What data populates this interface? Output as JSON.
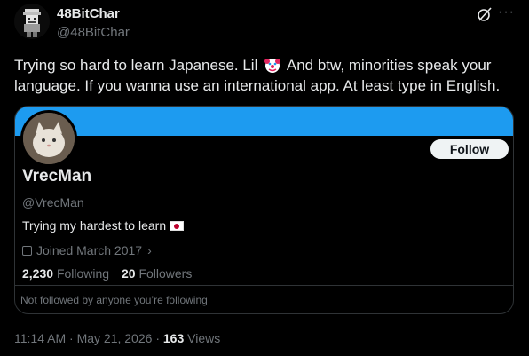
{
  "post": {
    "author_name": "48BitChar",
    "author_handle": "@48BitChar",
    "text_before_emoji": "Trying so hard to learn Japanese. Lil ",
    "emoji_icon": "clown-face-icon",
    "text_after_emoji": " And btw, minorities speak your language. If you wanna use an international app. At least type in English.",
    "more_icon": "more-horizontal-icon",
    "grok_icon": "grok-icon"
  },
  "card": {
    "banner_color": "#1d9bf0",
    "follow_label": "Follow",
    "name": "VrecMan",
    "handle": "@VrecMan",
    "bio": "Trying my hardest to learn",
    "bio_icon": "japan-flag-icon",
    "joined": "Joined March 2017",
    "following_count": "2,230",
    "following_label": "Following",
    "followers_count": "20",
    "followers_label": "Followers",
    "footer": "Not followed by anyone you’re following"
  },
  "meta": {
    "time": "11:14 AM",
    "separator": "·",
    "date": "May 21, 2026",
    "views_count": "163",
    "views_label": "Views"
  }
}
